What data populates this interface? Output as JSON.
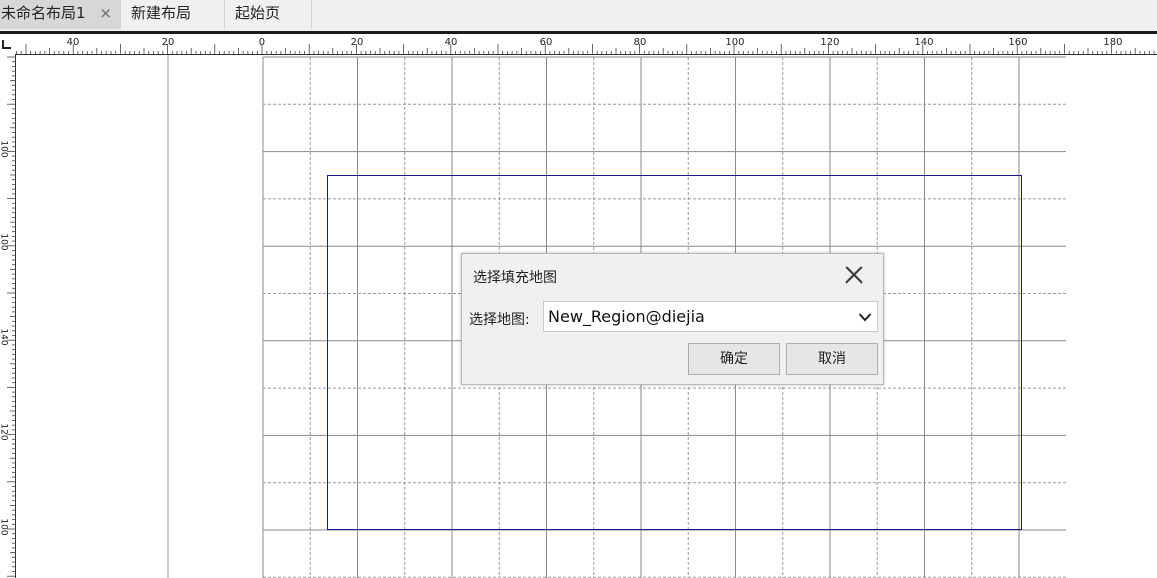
{
  "tabs": [
    {
      "label": "未命名布局1",
      "active": true,
      "closable": true
    },
    {
      "label": "新建布局",
      "active": false,
      "closable": false
    },
    {
      "label": "起始页",
      "active": false,
      "closable": false
    }
  ],
  "tab_close_glyph": "×",
  "ruler": {
    "horizontal_labels": [
      "40",
      "20",
      "0",
      "20",
      "40",
      "60",
      "80",
      "100",
      "120",
      "140",
      "160",
      "180"
    ],
    "vertical_labels": [
      "100",
      "100",
      "140",
      "120",
      "100"
    ]
  },
  "dialog": {
    "title": "选择填充地图",
    "field_label": "选择地图:",
    "selected_map": "New_Region@diejia",
    "ok_label": "确定",
    "cancel_label": "取消",
    "close_icon": "close-icon",
    "dropdown_icon": "chevron-down-icon"
  },
  "colors": {
    "map_frame": "#1a1a8c",
    "grid": "#8a8a8a",
    "dialog_bg": "#f0f0f0",
    "active_tab": "#d7d7d7"
  }
}
